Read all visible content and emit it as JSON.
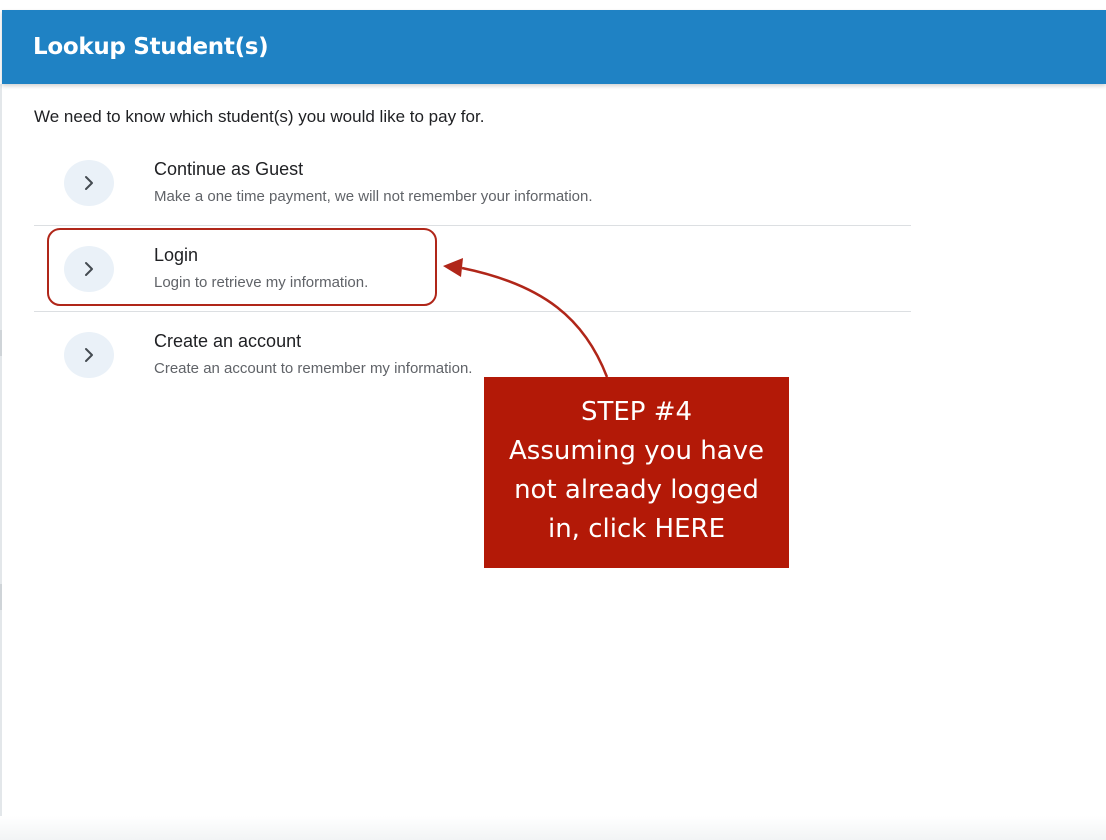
{
  "header": {
    "title": "Lookup Student(s)"
  },
  "intro": "We need to know which student(s) you would like to pay for.",
  "options": [
    {
      "title": "Continue as Guest",
      "subtitle": "Make a one time payment, we will not remember your information.",
      "icon": "chevron-right-icon"
    },
    {
      "title": "Login",
      "subtitle": "Login to retrieve my information.",
      "icon": "chevron-right-icon"
    },
    {
      "title": "Create an account",
      "subtitle": "Create an account to remember my information.",
      "icon": "chevron-right-icon"
    }
  ],
  "annotation": {
    "lines": [
      "STEP #4",
      "Assuming you have",
      "not already logged",
      "in, click HERE"
    ]
  },
  "colors": {
    "header_bg": "#1f82c4",
    "annotation_bg": "#b31907",
    "annotation_outline": "#b02619",
    "chevron_circle": "#eaf1f8"
  }
}
